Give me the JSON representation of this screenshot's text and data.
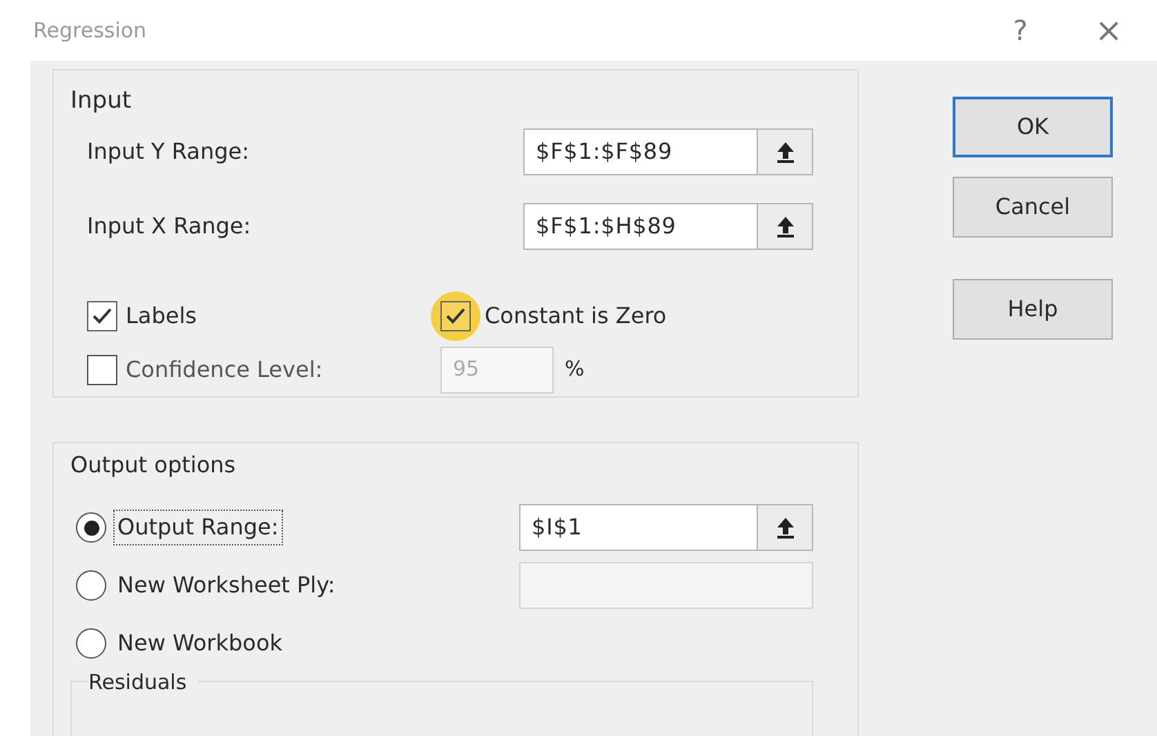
{
  "window": {
    "title": "Regression",
    "help_button": "?",
    "close_button": "×"
  },
  "input": {
    "title": "Input",
    "ranges": [
      {
        "label": "Input Y Range:",
        "value": "$F$1:$F$89"
      },
      {
        "label": "Input X Range:",
        "value": "$F$1:$H$89"
      }
    ],
    "labels": {
      "label": "Labels",
      "checked": true
    },
    "constant_is_zero": {
      "label": "Constant is Zero",
      "checked": true,
      "highlighted": true
    },
    "confidence": {
      "label": "Confidence Level:",
      "checked": false,
      "value": "95",
      "unit": "%"
    }
  },
  "buttons": [
    {
      "label": "OK",
      "default": true
    },
    {
      "label": "Cancel",
      "default": false
    },
    {
      "label": "Help",
      "default": false
    }
  ],
  "output": {
    "title": "Output options",
    "options": [
      {
        "label": "Output Range:",
        "selected": true,
        "value": "$I$1",
        "focused": true
      },
      {
        "label": "New Worksheet Ply:",
        "selected": false,
        "focused": false,
        "has_field": true
      },
      {
        "label": "New Workbook",
        "selected": false,
        "focused": false
      }
    ],
    "residuals_title": "Residuals"
  }
}
